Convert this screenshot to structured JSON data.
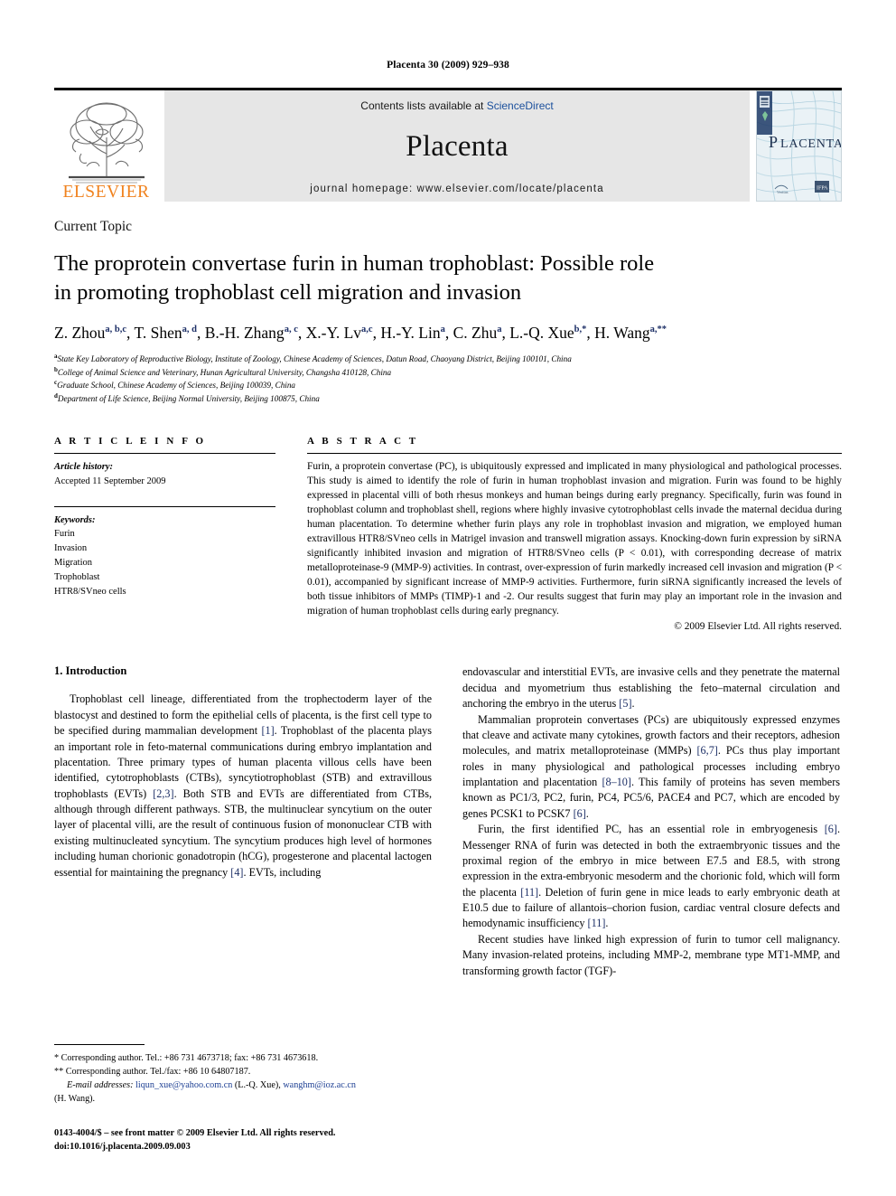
{
  "running_head": "Placenta 30 (2009) 929–938",
  "masthead": {
    "publisher_name": "ELSEVIER",
    "contents_prefix": "Contents lists available at ",
    "contents_link": "ScienceDirect",
    "journal_name": "Placenta",
    "homepage": "journal homepage: www.elsevier.com/locate/placenta",
    "cover_title": "PLACENTA",
    "link_color": "#1a4f9c",
    "elsevier_orange": "#F0821E"
  },
  "article": {
    "kicker": "Current Topic",
    "title_line1": "The proprotein convertase furin in human trophoblast: Possible role",
    "title_line2": "in promoting trophoblast cell migration and invasion",
    "authors": [
      {
        "name": "Z. Zhou",
        "sup": "a, b,c"
      },
      {
        "name": "T. Shen",
        "sup": "a, d"
      },
      {
        "name": "B.-H. Zhang",
        "sup": "a, c"
      },
      {
        "name": "X.-Y. Lv",
        "sup": "a,c"
      },
      {
        "name": "H.-Y. Lin",
        "sup": "a"
      },
      {
        "name": "C. Zhu",
        "sup": "a"
      },
      {
        "name": "L.-Q. Xue",
        "sup": "b,*"
      },
      {
        "name": "H. Wang",
        "sup": "a,**"
      }
    ],
    "affiliations": [
      {
        "marker": "a",
        "text": "State Key Laboratory of Reproductive Biology, Institute of Zoology, Chinese Academy of Sciences, Datun Road, Chaoyang District, Beijing 100101, China"
      },
      {
        "marker": "b",
        "text": "College of Animal Science and Veterinary, Hunan Agricultural University, Changsha 410128, China"
      },
      {
        "marker": "c",
        "text": "Graduate School, Chinese Academy of Sciences, Beijing 100039, China"
      },
      {
        "marker": "d",
        "text": "Department of Life Science, Beijing Normal University, Beijing 100875, China"
      }
    ]
  },
  "article_info": {
    "heading": "A R T I C L E    I N F O",
    "history_label": "Article history:",
    "history_value": "Accepted 11 September 2009",
    "keywords_label": "Keywords:",
    "keywords": [
      "Furin",
      "Invasion",
      "Migration",
      "Trophoblast",
      "HTR8/SVneo cells"
    ]
  },
  "abstract": {
    "heading": "A B S T R A C T",
    "body": "Furin, a proprotein convertase (PC), is ubiquitously expressed and implicated in many physiological and pathological processes. This study is aimed to identify the role of furin in human trophoblast invasion and migration. Furin was found to be highly expressed in placental villi of both rhesus monkeys and human beings during early pregnancy. Specifically, furin was found in trophoblast column and trophoblast shell, regions where highly invasive cytotrophoblast cells invade the maternal decidua during human placentation. To determine whether furin plays any role in trophoblast invasion and migration, we employed human extravillous HTR8/SVneo cells in Matrigel invasion and transwell migration assays. Knocking-down furin expression by siRNA significantly inhibited invasion and migration of HTR8/SVneo cells (P < 0.01), with corresponding decrease of matrix metalloproteinase-9 (MMP-9) activities. In contrast, over-expression of furin markedly increased cell invasion and migration (P < 0.01), accompanied by significant increase of MMP-9 activities. Furthermore, furin siRNA significantly increased the levels of both tissue inhibitors of MMPs (TIMP)-1 and -2. Our results suggest that furin may play an important role in the invasion and migration of human trophoblast cells during early pregnancy.",
    "copyright": "© 2009 Elsevier Ltd. All rights reserved."
  },
  "introduction": {
    "section_number_title": "1.  Introduction",
    "left_para_1_a": "Trophoblast cell lineage, differentiated from the trophectoderm layer of the blastocyst and destined to form the epithelial cells of placenta, is the first cell type to be specified during mammalian development ",
    "left_para_1_ref1": "[1]",
    "left_para_1_b": ". Trophoblast of the placenta plays an important role in feto-maternal communications during embryo implantation and placentation. Three primary types of human placenta villous cells have been identified, cytotrophoblasts (CTBs), syncytiotrophoblast (STB) and extravillous trophoblasts (EVTs) ",
    "left_para_1_ref2": "[2,3]",
    "left_para_1_c": ". Both STB and EVTs are differentiated from CTBs, although through different pathways. STB, the multinuclear syncytium on the outer layer of placental villi, are the result of continuous fusion of mononuclear CTB with existing multinucleated syncytium. The syncytium produces high level of hormones including human chorionic gonadotropin (hCG), progesterone and placental lactogen essential for maintaining the pregnancy ",
    "left_para_1_ref3": "[4]",
    "left_para_1_d": ". EVTs, including",
    "right_para_1_a": "endovascular and interstitial EVTs, are invasive cells and they penetrate the maternal decidua and myometrium thus establishing the feto–maternal circulation and anchoring the embryo in the uterus ",
    "right_para_1_ref": "[5]",
    "right_para_1_b": ".",
    "right_para_2_a": "Mammalian proprotein convertases (PCs) are ubiquitously expressed enzymes that cleave and activate many cytokines, growth factors and their receptors, adhesion molecules, and matrix metalloproteinase (MMPs) ",
    "right_para_2_ref1": "[6,7]",
    "right_para_2_b": ". PCs thus play important roles in many physiological and pathological processes including embryo implantation and placentation ",
    "right_para_2_ref2": "[8–10]",
    "right_para_2_c": ". This family of proteins has seven members known as PC1/3, PC2, furin, PC4, PC5/6, PACE4 and PC7, which are encoded by genes PCSK1 to PCSK7 ",
    "right_para_2_ref3": "[6]",
    "right_para_2_d": ".",
    "right_para_3_a": "Furin, the first identified PC, has an essential role in embryogenesis ",
    "right_para_3_ref1": "[6]",
    "right_para_3_b": ". Messenger RNA of furin was detected in both the extraembryonic tissues and the proximal region of the embryo in mice between E7.5 and E8.5, with strong expression in the extra-embryonic mesoderm and the chorionic fold, which will form the placenta ",
    "right_para_3_ref2": "[11]",
    "right_para_3_c": ". Deletion of furin gene in mice leads to early embryonic death at E10.5 due to failure of allantois–chorion fusion, cardiac ventral closure defects and hemodynamic insufficiency ",
    "right_para_3_ref3": "[11]",
    "right_para_3_d": ".",
    "right_para_4": "Recent studies have linked high expression of furin to tumor cell malignancy. Many invasion-related proteins, including MMP-2, membrane type MT1-MMP, and transforming growth factor (TGF)-"
  },
  "footnotes": {
    "corr1": "*  Corresponding author. Tel.: +86 731 4673718; fax: +86 731 4673618.",
    "corr2": "**  Corresponding author. Tel./fax: +86 10 64807187.",
    "email_label": "E-mail addresses:",
    "email1": "liqun_xue@yahoo.com.cn",
    "email1_owner": "(L.-Q. Xue)",
    "email2": "wanghm@ioz.ac.cn",
    "email2_owner": "(H. Wang).",
    "imprint_line1": "0143-4004/$ – see front matter © 2009 Elsevier Ltd. All rights reserved.",
    "imprint_line2": "doi:10.1016/j.placenta.2009.09.003"
  }
}
